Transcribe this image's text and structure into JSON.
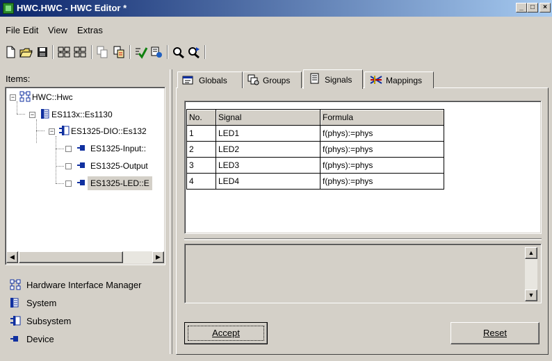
{
  "window": {
    "title": "HWC.HWC - HWC Editor  *",
    "controls": [
      "_",
      "□",
      "×"
    ]
  },
  "menu": {
    "items": [
      {
        "label": "File"
      },
      {
        "label": "Edit"
      },
      {
        "label": "View"
      },
      {
        "label": "Extras"
      }
    ]
  },
  "toolbar": {
    "buttons": [
      "new-file-icon",
      "open-folder-icon",
      "save-icon",
      "add-tree-icon",
      "tree-icon",
      "copy-icon",
      "paste-icon",
      "check-icon",
      "validate-icon",
      "search-icon",
      "search-next-icon"
    ]
  },
  "left_pane": {
    "items_label": "Items:",
    "tree": [
      {
        "label": "HWC::Hwc",
        "icon": "hardware-manager-icon",
        "level": 0,
        "expander": "−"
      },
      {
        "label": "ES113x::Es1130",
        "icon": "system-icon",
        "level": 1,
        "expander": "−"
      },
      {
        "label": "ES1325-DIO::Es132",
        "icon": "subsystem-icon",
        "level": 2,
        "expander": "−"
      },
      {
        "label": "ES1325-Input::",
        "icon": "device-icon",
        "level": 3
      },
      {
        "label": "ES1325-Output",
        "icon": "device-icon",
        "level": 3
      },
      {
        "label": "ES1325-LED::E",
        "icon": "device-icon",
        "level": 3,
        "selected": true
      }
    ],
    "legend": [
      {
        "label": "Hardware Interface Manager",
        "icon": "hardware-manager-icon"
      },
      {
        "label": "System",
        "icon": "system-icon"
      },
      {
        "label": "Subsystem",
        "icon": "subsystem-icon"
      },
      {
        "label": "Device",
        "icon": "device-icon"
      }
    ]
  },
  "tabs": [
    {
      "label": "Globals",
      "icon": "globals-icon",
      "active": false
    },
    {
      "label": "Groups",
      "icon": "groups-icon",
      "active": false
    },
    {
      "label": "Signals",
      "icon": "signals-icon",
      "active": true
    },
    {
      "label": "Mappings",
      "icon": "mappings-icon",
      "active": false
    }
  ],
  "signals_table": {
    "columns": [
      "No.",
      "Signal",
      "Formula"
    ],
    "rows": [
      [
        "1",
        "LED1",
        "f(phys):=phys"
      ],
      [
        "2",
        "LED2",
        "f(phys):=phys"
      ],
      [
        "3",
        "LED3",
        "f(phys):=phys"
      ],
      [
        "4",
        "LED4",
        "f(phys):=phys"
      ]
    ]
  },
  "buttons": {
    "accept": "Accept",
    "reset": "Reset"
  },
  "colors": {
    "title_start": "#0a246a",
    "title_end": "#a6caf0",
    "face": "#d4d0c8"
  }
}
